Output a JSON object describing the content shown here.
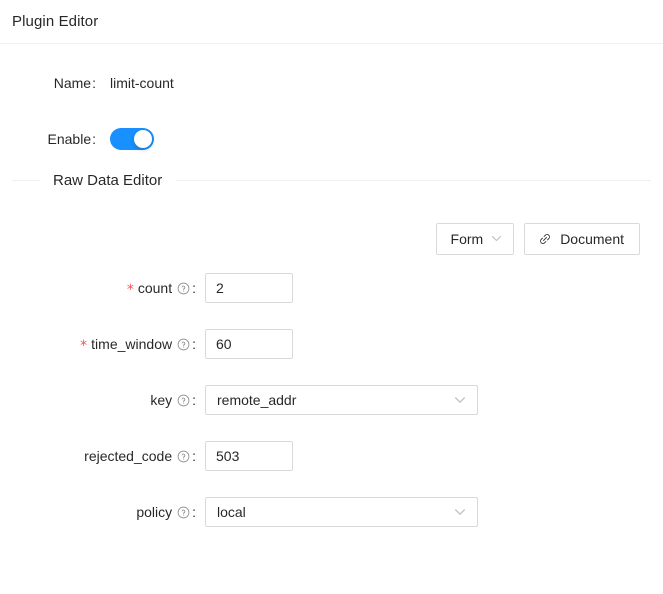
{
  "header": {
    "title": "Plugin Editor"
  },
  "form": {
    "name": {
      "label": "Name",
      "colon": ":",
      "value": "limit-count"
    },
    "enable": {
      "label": "Enable",
      "colon": ":",
      "checked": true,
      "accent_color": "#1890ff"
    }
  },
  "section": {
    "legend": "Raw Data Editor"
  },
  "toolbar": {
    "mode_button": {
      "label": "Form",
      "caret_icon": "chevron-down-icon"
    },
    "document_button": {
      "label": "Document",
      "icon": "link-icon"
    }
  },
  "fields": [
    {
      "key": "count",
      "label": "count",
      "colon": ":",
      "required": true,
      "required_marker": "*",
      "help_icon": "question-circle-icon",
      "control": "input",
      "value": "2",
      "placeholder": ""
    },
    {
      "key": "time_window",
      "label": "time_window",
      "colon": ":",
      "required": true,
      "required_marker": "*",
      "help_icon": "question-circle-icon",
      "control": "input",
      "value": "60",
      "placeholder": ""
    },
    {
      "key": "key",
      "label": "key",
      "colon": ":",
      "required": false,
      "required_marker": "",
      "help_icon": "question-circle-icon",
      "control": "select",
      "value": "remote_addr",
      "arrow_icon": "chevron-down-icon"
    },
    {
      "key": "rejected_code",
      "label": "rejected_code",
      "colon": ":",
      "required": false,
      "required_marker": "",
      "help_icon": "question-circle-icon",
      "control": "input",
      "value": "503",
      "placeholder": ""
    },
    {
      "key": "policy",
      "label": "policy",
      "colon": ":",
      "required": false,
      "required_marker": "",
      "help_icon": "question-circle-icon",
      "control": "select",
      "value": "local",
      "arrow_icon": "chevron-down-icon"
    }
  ],
  "colors": {
    "accent": "#1890ff",
    "required": "#ff4d4f",
    "border": "#d9d9d9",
    "divider": "#f0f0f0"
  }
}
